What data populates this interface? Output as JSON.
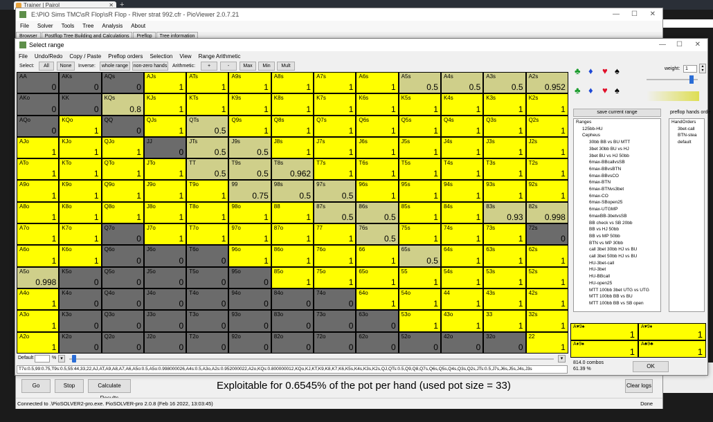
{
  "browser": {
    "tab_title": "Trainer | Pairol"
  },
  "main_window": {
    "title": "E:\\PIO Sims TMC\\sR Flop\\sR Flop - River strat 992.cfr - PioViewer 2.0.7.21",
    "menu": [
      "File",
      "Solver",
      "Tools",
      "Tree",
      "Analysis",
      "About"
    ],
    "tabs": [
      "Browser",
      "Postflop Tree Building and Calculations",
      "Preflop",
      "Tree information"
    ],
    "buttons": {
      "go": "Go",
      "stop": "Stop",
      "calculate": "Calculate Results",
      "clear_logs": "Clear logs"
    },
    "exploit_text": "Exploitable for 0.6545% of the pot per hand (used pot size = 33)",
    "status_text": "Connected to .\\PioSOLVER2-pro.exe. PioSOLVER-pro 2.0.8 (Feb 16 2022, 13:03:45)",
    "status_right": "Done"
  },
  "dialog": {
    "title": "Select range",
    "menu": [
      "File",
      "Undo/Redo",
      "Copy / Paste",
      "Preflop orders",
      "Selection",
      "View",
      "Range Arithmetic"
    ],
    "toolbar": {
      "select_label": "Select:",
      "all": "All",
      "none": "None",
      "inverse_label": "Inverse:",
      "whole_range": "whole range",
      "nonzero_hands": "non-zero hands",
      "arithmetic_label": "Arithmetic:",
      "plus": "+",
      "minus": "-",
      "max": "Max",
      "min": "Min",
      "mult": "Mult"
    },
    "default_label": "Default",
    "percent_sign": "%",
    "combo_string": "T7o:0.5,99:0.75,T9s:0.5,55:44,33,22,AJ,AT,A9,A8,A7,A6,A5o:0.5,A5o:0.998000026,A4s:0.5,A3o,A2s:0.952000022,A2o,KQs:0.800000012,KQo,KJ,KT,K9,K8,K7,K6,K5s,K4s,K3s,K2s,QJ,QTs:0.5,Q9,Q8,Q7s,Q6s,Q5s,Q4s,Q3s,Q2s,JTs:0.5,J7s,J6s,J5s,J4s,J3s",
    "weight_label": "weight:",
    "weight_value": "1",
    "save_range_label": "save current range",
    "preflop_orders_label": "preflop hands orde",
    "ranges_tree": [
      "Ranges",
      "125bb-HU",
      "Cepheus",
      "30bb BB vs BU MTT",
      "3bet 30bb BU vs HJ",
      "3bet BU vs HJ 50bb",
      "6max-BBcallvsSB",
      "6max-BBvsBTN",
      "6max-BBvsCO",
      "6max-BTN",
      "6max-BTNvs3bet",
      "6max-CO",
      "6max-SBopen25",
      "6max-UTGMP",
      "6maxBB-3betvsSB",
      "BB check vs SB 20bb",
      "BB vs HJ 50bb",
      "BB vs MP 50bb",
      "BTN vs MP 30bb",
      "call 3bet 30bb HJ vs BU",
      "call 3bet 50bb HJ vs BU",
      "HU-3bet-call",
      "HU-3bet",
      "HU-BBcall",
      "HU-open25",
      "MTT 100bb 3bet UTG vs UTG",
      "MTT 100bb BB vs BU",
      "MTT 100bb BB vs SB open"
    ],
    "orders_tree": [
      "HandOrders",
      "3bet-call",
      "BTN-stea",
      "default"
    ],
    "board_cells": [
      {
        "name": "A♥9♠",
        "value": "1"
      },
      {
        "name": "A♥9♦",
        "value": "1"
      },
      {
        "name": "A♦9♠",
        "value": "1"
      },
      {
        "name": "A♣9♣",
        "value": "1"
      }
    ],
    "combos_text": "814.0 combos",
    "combos_pct": "61.39 %",
    "ok": "OK"
  },
  "colors": {
    "full": "#ffff00",
    "zero": "#6b6b6b",
    "partial": "#cfcf8a"
  },
  "hands": [
    [
      "AA",
      "0"
    ],
    [
      "AKs",
      "0"
    ],
    [
      "AQs",
      "0"
    ],
    [
      "AJs",
      "1"
    ],
    [
      "ATs",
      "1"
    ],
    [
      "A9s",
      "1"
    ],
    [
      "A8s",
      "1"
    ],
    [
      "A7s",
      "1"
    ],
    [
      "A6s",
      "1"
    ],
    [
      "A5s",
      "0.5"
    ],
    [
      "A4s",
      "0.5"
    ],
    [
      "A3s",
      "0.5"
    ],
    [
      "A2s",
      "0.952"
    ],
    [
      "AKo",
      "0"
    ],
    [
      "KK",
      "0"
    ],
    [
      "KQs",
      "0.8"
    ],
    [
      "KJs",
      "1"
    ],
    [
      "KTs",
      "1"
    ],
    [
      "K9s",
      "1"
    ],
    [
      "K8s",
      "1"
    ],
    [
      "K7s",
      "1"
    ],
    [
      "K6s",
      "1"
    ],
    [
      "K5s",
      "1"
    ],
    [
      "K4s",
      "1"
    ],
    [
      "K3s",
      "1"
    ],
    [
      "K2s",
      "1"
    ],
    [
      "AQo",
      "0"
    ],
    [
      "KQo",
      "1"
    ],
    [
      "QQ",
      "0"
    ],
    [
      "QJs",
      "1"
    ],
    [
      "QTs",
      "0.5"
    ],
    [
      "Q9s",
      "1"
    ],
    [
      "Q8s",
      "1"
    ],
    [
      "Q7s",
      "1"
    ],
    [
      "Q6s",
      "1"
    ],
    [
      "Q5s",
      "1"
    ],
    [
      "Q4s",
      "1"
    ],
    [
      "Q3s",
      "1"
    ],
    [
      "Q2s",
      "1"
    ],
    [
      "AJo",
      "1"
    ],
    [
      "KJo",
      "1"
    ],
    [
      "QJo",
      "1"
    ],
    [
      "JJ",
      "0"
    ],
    [
      "JTs",
      "0.5"
    ],
    [
      "J9s",
      "0.5"
    ],
    [
      "J8s",
      "1"
    ],
    [
      "J7s",
      "1"
    ],
    [
      "J6s",
      "1"
    ],
    [
      "J5s",
      "1"
    ],
    [
      "J4s",
      "1"
    ],
    [
      "J3s",
      "1"
    ],
    [
      "J2s",
      "1"
    ],
    [
      "ATo",
      "1"
    ],
    [
      "KTo",
      "1"
    ],
    [
      "QTo",
      "1"
    ],
    [
      "JTo",
      "1"
    ],
    [
      "TT",
      "0.5"
    ],
    [
      "T9s",
      "0.5"
    ],
    [
      "T8s",
      "0.962"
    ],
    [
      "T7s",
      "1"
    ],
    [
      "T6s",
      "1"
    ],
    [
      "T5s",
      "1"
    ],
    [
      "T4s",
      "1"
    ],
    [
      "T3s",
      "1"
    ],
    [
      "T2s",
      "1"
    ],
    [
      "A9o",
      "1"
    ],
    [
      "K9o",
      "1"
    ],
    [
      "Q9o",
      "1"
    ],
    [
      "J9o",
      "1"
    ],
    [
      "T9o",
      "1"
    ],
    [
      "99",
      "0.75"
    ],
    [
      "98s",
      "0.5"
    ],
    [
      "97s",
      "0.5"
    ],
    [
      "96s",
      "1"
    ],
    [
      "95s",
      "1"
    ],
    [
      "94s",
      "1"
    ],
    [
      "93s",
      "1"
    ],
    [
      "92s",
      "1"
    ],
    [
      "A8o",
      "1"
    ],
    [
      "K8o",
      "1"
    ],
    [
      "Q8o",
      "1"
    ],
    [
      "J8o",
      "1"
    ],
    [
      "T8o",
      "1"
    ],
    [
      "98o",
      "1"
    ],
    [
      "88",
      "1"
    ],
    [
      "87s",
      "0.5"
    ],
    [
      "86s",
      "0.5"
    ],
    [
      "85s",
      "1"
    ],
    [
      "84s",
      "1"
    ],
    [
      "83s",
      "0.93"
    ],
    [
      "82s",
      "0.998"
    ],
    [
      "A7o",
      "1"
    ],
    [
      "K7o",
      "1"
    ],
    [
      "Q7o",
      "0"
    ],
    [
      "J7o",
      "1"
    ],
    [
      "T7o",
      "1"
    ],
    [
      "97o",
      "1"
    ],
    [
      "87o",
      "1"
    ],
    [
      "77",
      "1"
    ],
    [
      "76s",
      "0.5"
    ],
    [
      "75s",
      "1"
    ],
    [
      "74s",
      "1"
    ],
    [
      "73s",
      "1"
    ],
    [
      "72s",
      "0"
    ],
    [
      "A6o",
      "1"
    ],
    [
      "K6o",
      "1"
    ],
    [
      "Q6o",
      "0"
    ],
    [
      "J6o",
      "0"
    ],
    [
      "T6o",
      "0"
    ],
    [
      "96o",
      "1"
    ],
    [
      "86o",
      "1"
    ],
    [
      "76o",
      "1"
    ],
    [
      "66",
      "1"
    ],
    [
      "65s",
      "0.5"
    ],
    [
      "64s",
      "1"
    ],
    [
      "63s",
      "1"
    ],
    [
      "62s",
      "1"
    ],
    [
      "A5o",
      "0.998"
    ],
    [
      "K5o",
      "0"
    ],
    [
      "Q5o",
      "0"
    ],
    [
      "J5o",
      "0"
    ],
    [
      "T5o",
      "0"
    ],
    [
      "95o",
      "0"
    ],
    [
      "85o",
      "1"
    ],
    [
      "75o",
      "1"
    ],
    [
      "65o",
      "1"
    ],
    [
      "55",
      "1"
    ],
    [
      "54s",
      "1"
    ],
    [
      "53s",
      "1"
    ],
    [
      "52s",
      "1"
    ],
    [
      "A4o",
      "1"
    ],
    [
      "K4o",
      "0"
    ],
    [
      "Q4o",
      "0"
    ],
    [
      "J4o",
      "0"
    ],
    [
      "T4o",
      "0"
    ],
    [
      "94o",
      "0"
    ],
    [
      "84o",
      "0"
    ],
    [
      "74o",
      "0"
    ],
    [
      "64o",
      "1"
    ],
    [
      "54o",
      "1"
    ],
    [
      "44",
      "1"
    ],
    [
      "43s",
      "1"
    ],
    [
      "42s",
      "1"
    ],
    [
      "A3o",
      "1"
    ],
    [
      "K3o",
      "0"
    ],
    [
      "Q3o",
      "0"
    ],
    [
      "J3o",
      "0"
    ],
    [
      "T3o",
      "0"
    ],
    [
      "93o",
      "0"
    ],
    [
      "83o",
      "0"
    ],
    [
      "73o",
      "0"
    ],
    [
      "63o",
      "0"
    ],
    [
      "53o",
      "1"
    ],
    [
      "43o",
      "1"
    ],
    [
      "33",
      "1"
    ],
    [
      "32s",
      "1"
    ],
    [
      "A2o",
      "1"
    ],
    [
      "K2o",
      "0"
    ],
    [
      "Q2o",
      "0"
    ],
    [
      "J2o",
      "0"
    ],
    [
      "T2o",
      "0"
    ],
    [
      "92o",
      "0"
    ],
    [
      "82o",
      "0"
    ],
    [
      "72o",
      "0"
    ],
    [
      "62o",
      "0"
    ],
    [
      "52o",
      "0"
    ],
    [
      "42o",
      "0"
    ],
    [
      "32o",
      "0"
    ],
    [
      "22",
      "1"
    ]
  ]
}
